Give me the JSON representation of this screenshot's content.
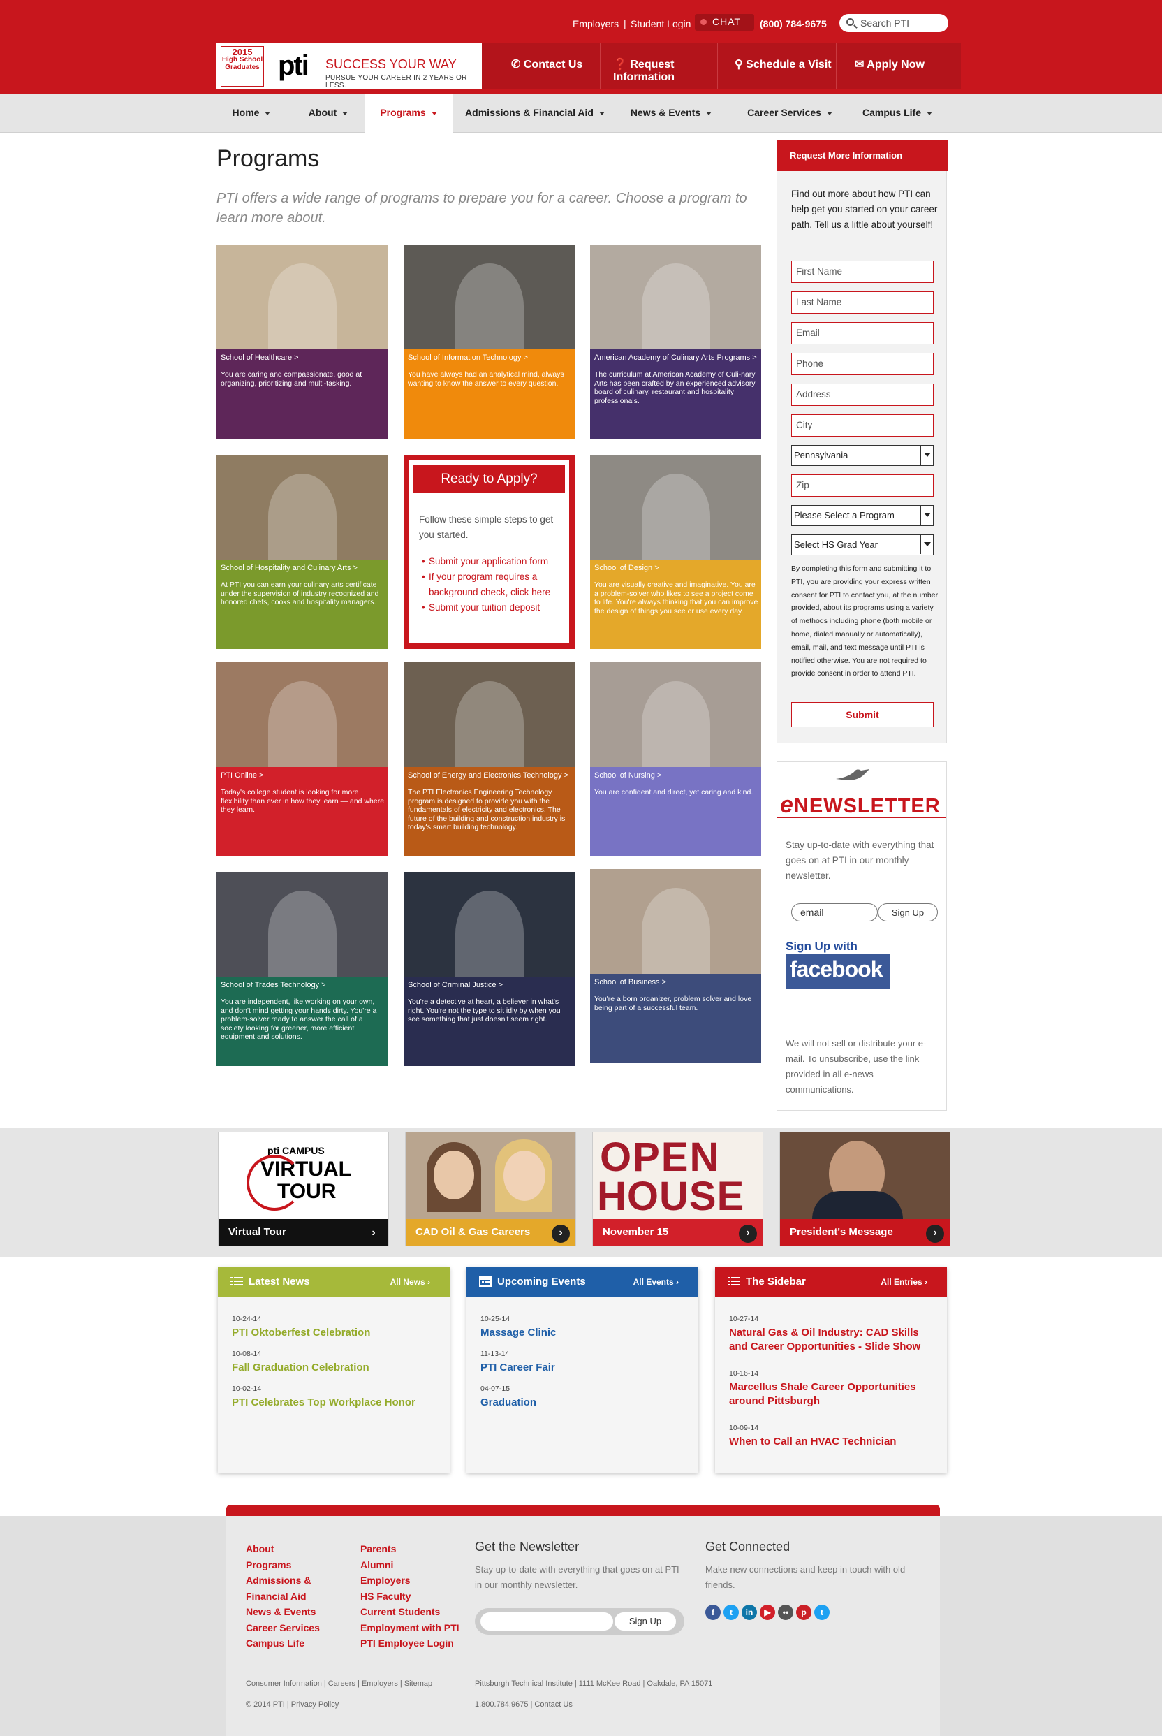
{
  "header": {
    "links": [
      "Employers",
      "|",
      "Student Login"
    ],
    "chat": "CHAT",
    "phone": "(800) 784-9675",
    "search_placeholder": "Search PTI",
    "badge_year": "2015",
    "badge_text": "High School Graduates",
    "logo": "pti",
    "tagline": "SUCCESS YOUR WAY",
    "subline": "PURSUE YOUR CAREER IN 2 YEARS OR LESS.",
    "actions": [
      "Contact Us",
      "Request Information",
      "Schedule a Visit",
      "Apply Now"
    ]
  },
  "nav": [
    "Home",
    "About",
    "Programs",
    "Admissions & Financial Aid",
    "News & Events",
    "Career Services",
    "Campus Life"
  ],
  "main": {
    "title": "Programs",
    "intro": "PTI offers a wide range of programs to prepare you for a career. Choose a program to learn more about.",
    "programs": [
      {
        "title": "School of Healthcare >",
        "desc": "You are caring and compassionate, good at organizing, prioritizing and multi-tasking.",
        "color": "#5e2659"
      },
      {
        "title": "School of Information Technology >",
        "desc": "You have always had an analytical mind, always wanting to know the answer to every question.",
        "color": "#f08a0c"
      },
      {
        "title": "American Academy of Culinary Arts Programs >",
        "desc": "The curriculum at American Academy of Culi-nary Arts has been crafted by an experienced advisory board of culinary, restaurant and hospitality professionals.",
        "color": "#45306b"
      },
      {
        "title": "School of Hospitality and Culinary Arts >",
        "desc": "At PTI you can earn your culinary arts certificate under the supervision of industry recognized and honored chefs, cooks and hospitality managers.",
        "color": "#7b9a2c"
      },
      {
        "title": "School of Design >",
        "desc": "You are visually creative and imaginative. You are a problem-solver who likes to see a project come to life. You're always thinking that you can improve the design of things you see or use every day.",
        "color": "#e4a82a"
      },
      {
        "title": "PTI Online >",
        "desc": "Today's college student is looking for more flexibility than ever in how they learn — and where they learn.",
        "color": "#d2202a"
      },
      {
        "title": "School of Energy and Electronics Technology >",
        "desc": "The PTI Electronics Engineering Technology program is designed to provide you with the fundamentals of electricity and electronics. The future of the building and construction industry is today's smart building technology.",
        "color": "#b95a17"
      },
      {
        "title": "School of Nursing >",
        "desc": "You are confident and direct, yet caring and kind.",
        "color": "#7873c4"
      },
      {
        "title": "School of Trades Technology >",
        "desc": "You are independent, like working on your own, and don't mind getting your hands dirty. You're a problem-solver ready to answer the call of a society looking for greener, more efficient equipment and solutions.",
        "color": "#1d6b53"
      },
      {
        "title": "School of Criminal Justice >",
        "desc": "You're a detective at heart, a believer in what's right. You're not the type to sit idly by when you see something that just doesn't seem right.",
        "color": "#2a2d50"
      },
      {
        "title": "School of Business >",
        "desc": "You're a born organizer, problem solver and love being part of a successful team.",
        "color": "#3d4c7b"
      }
    ],
    "apply": {
      "title": "Ready to Apply?",
      "text": "Follow these simple steps to get you started.",
      "steps": [
        "Submit your application form",
        "If your program requires a background check, click here",
        "Submit your tuition deposit"
      ]
    }
  },
  "sidebar": {
    "request_title": "Request More Information",
    "request_text": "Find out more about how PTI can help get you started on your career path. Tell us a little about yourself!",
    "fields": [
      "First Name",
      "Last Name",
      "Email",
      "Phone",
      "Address",
      "City"
    ],
    "state": "Pennsylvania",
    "zip": "Zip",
    "program_select": "Please Select a Program",
    "grad_select": "Select HS Grad Year",
    "consent": "By completing this form and submitting it to PTI, you are providing your express written consent for PTI to contact you, at the number provided, about its programs using a variety of methods including phone (both mobile or home, dialed manually or automatically), email, mail, and text message until PTI is notified otherwise. You are not required to provide consent in order to attend PTI.",
    "submit": "Submit",
    "newsletter": {
      "title_e": "e",
      "title": "NEWSLETTER",
      "text": "Stay up-to-date with everything that goes on at PTI in our monthly newsletter.",
      "email_placeholder": "email",
      "button": "Sign Up",
      "fb_text": "Sign Up with",
      "fb_logo": "facebook",
      "foot": "We will not sell or distribute your e-mail. To unsubscribe, use the link provided in all e-news communications."
    }
  },
  "promos": [
    {
      "label": "Virtual Tour",
      "art_top": "pti CAMPUS",
      "art_main": "VIRTUAL",
      "art_sub": "TOUR",
      "color": "#111111"
    },
    {
      "label": "CAD Oil & Gas Careers",
      "color": "#e4a82a"
    },
    {
      "label": "November 15",
      "art_main": "OPEN",
      "art_sub": "HOUSE",
      "color": "#d2202a"
    },
    {
      "label": "President's Message",
      "color": "#c8161d"
    }
  ],
  "columns": [
    {
      "title": "Latest News",
      "all": "All News ›",
      "color": "#a6b93a",
      "link_color": "#94ab2a",
      "items": [
        {
          "date": "10-24-14",
          "text": "PTI Oktoberfest Celebration"
        },
        {
          "date": "10-08-14",
          "text": "Fall Graduation Celebration"
        },
        {
          "date": "10-02-14",
          "text": "PTI Celebrates Top Workplace Honor"
        }
      ]
    },
    {
      "title": "Upcoming Events",
      "all": "All Events ›",
      "color": "#1f5fa8",
      "link_color": "#1f5fa8",
      "items": [
        {
          "date": "10-25-14",
          "text": "Massage Clinic"
        },
        {
          "date": "11-13-14",
          "text": "PTI Career Fair"
        },
        {
          "date": "04-07-15",
          "text": "Graduation"
        }
      ]
    },
    {
      "title": "The Sidebar",
      "all": "All Entries ›",
      "color": "#c8161d",
      "link_color": "#c8161d",
      "items": [
        {
          "date": "10-27-14",
          "text": "Natural Gas & Oil Industry: CAD Skills and Career Opportunities - Slide Show"
        },
        {
          "date": "10-16-14",
          "text": "Marcellus Shale Career Opportunities around Pittsburgh"
        },
        {
          "date": "10-09-14",
          "text": "When to Call an HVAC Technician"
        }
      ]
    }
  ],
  "footer": {
    "col1": [
      "About",
      "Programs",
      "Admissions &",
      "Financial Aid",
      "News & Events",
      "Career Services",
      "Campus Life"
    ],
    "col2": [
      "Parents",
      "Alumni",
      "Employers",
      "HS Faculty",
      "Current Students",
      "Employment with PTI",
      "PTI Employee Login"
    ],
    "newsletter_title": "Get the Newsletter",
    "newsletter_text": "Stay up-to-date with everything that goes on at PTI in our monthly newsletter.",
    "signup": "Sign Up",
    "connected_title": "Get Connected",
    "connected_text": "Make new connections and keep in touch with old friends.",
    "legal_links": "Consumer Information | Careers | Employers | Sitemap",
    "copyright": "© 2014 PTI  |  Privacy Policy",
    "address": "Pittsburgh Technical Institute  |  1111 McKee Road  |  Oakdale, PA 15071",
    "contact": "1.800.784.9675  |  Contact Us",
    "social": [
      {
        "icon": "facebook-icon",
        "glyph": "f",
        "color": "#3b5998"
      },
      {
        "icon": "twitter-icon",
        "glyph": "t",
        "color": "#1da1f2"
      },
      {
        "icon": "linkedin-icon",
        "glyph": "in",
        "color": "#0e76a8"
      },
      {
        "icon": "youtube-icon",
        "glyph": "▶",
        "color": "#d2202a"
      },
      {
        "icon": "flickr-icon",
        "glyph": "••",
        "color": "#555555"
      },
      {
        "icon": "pinterest-icon",
        "glyph": "p",
        "color": "#cb2027"
      },
      {
        "icon": "twitter-alt-icon",
        "glyph": "t",
        "color": "#1da1f2"
      }
    ]
  }
}
